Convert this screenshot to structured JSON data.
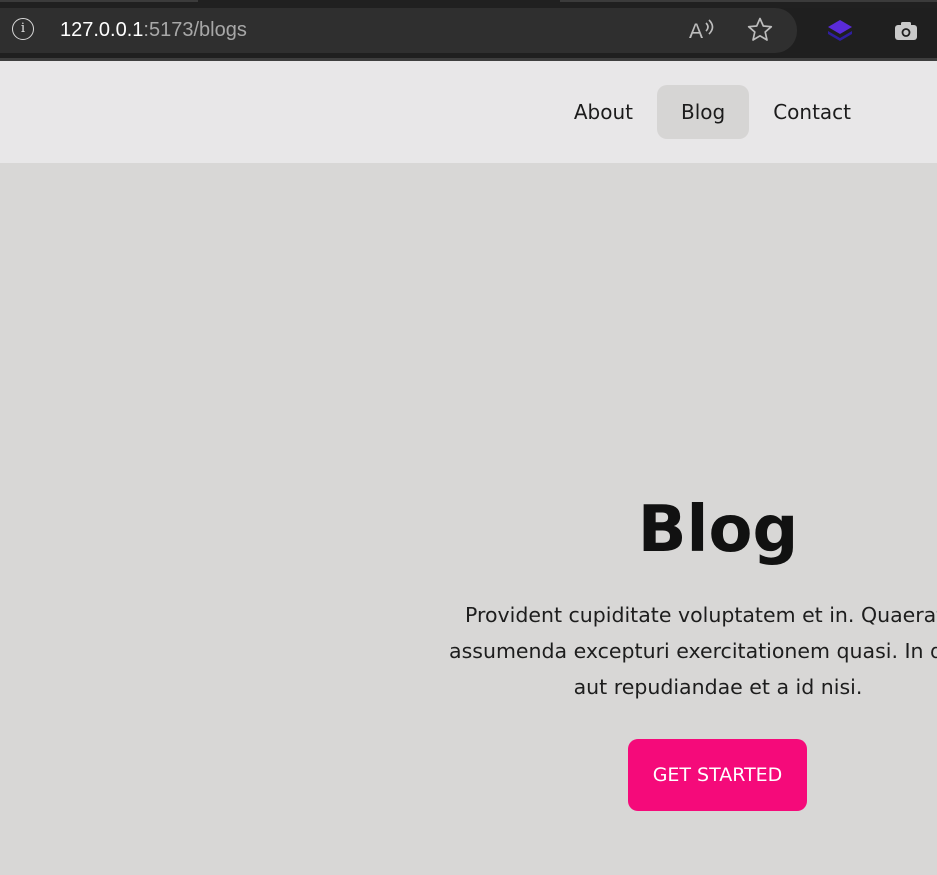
{
  "browser": {
    "url_host": "127.0.0.1",
    "url_path": ":5173/blogs",
    "icons": [
      "info-icon",
      "read-aloud-icon",
      "favorite-star-icon",
      "extension-icon",
      "camera-icon"
    ],
    "colors": {
      "chrome_bg": "#1f1f1f",
      "addressbar_bg": "#2f2f2f"
    }
  },
  "nav": {
    "items": [
      {
        "label": "About",
        "active": false
      },
      {
        "label": "Blog",
        "active": true
      },
      {
        "label": "Contact",
        "active": false
      }
    ]
  },
  "hero": {
    "title": "Blog",
    "description_lines": [
      "Provident cupiditate voluptatem et in. Quaerat fu",
      "assumenda excepturi exercitationem quasi. In delen",
      "aut repudiandae et a id nisi."
    ],
    "cta_label": "GET STARTED"
  },
  "colors": {
    "header_bg": "#e8e7e8",
    "hero_bg": "#d8d7d6",
    "nav_active_bg": "#d6d5d4",
    "cta_bg": "#f50a7a",
    "cta_text": "#ffffff"
  }
}
